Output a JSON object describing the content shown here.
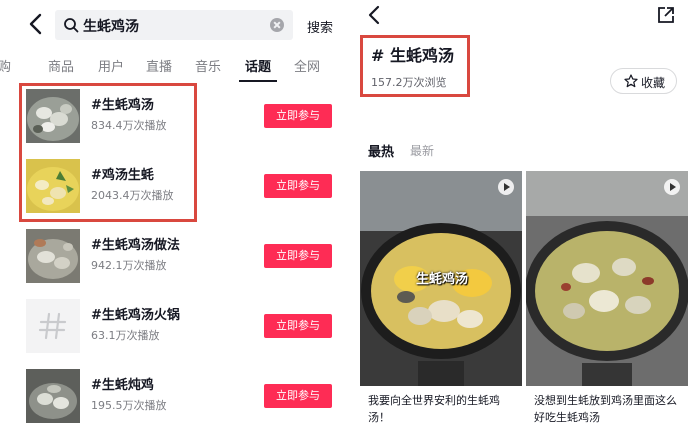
{
  "search": {
    "query": "生蚝鸡汤",
    "button": "搜索",
    "icons": {
      "back": "chevron-left-icon",
      "search": "search-icon",
      "clear": "clear-icon"
    }
  },
  "tabs": [
    {
      "label": "购",
      "active": false
    },
    {
      "label": "商品",
      "active": false
    },
    {
      "label": "用户",
      "active": false
    },
    {
      "label": "直播",
      "active": false
    },
    {
      "label": "音乐",
      "active": false
    },
    {
      "label": "话题",
      "active": true
    },
    {
      "label": "全网",
      "active": false
    }
  ],
  "results": [
    {
      "title": "#生蚝鸡汤",
      "stats": "834.4万次播放",
      "button": "立即参与",
      "thumb": "oyster-soup-photo"
    },
    {
      "title": "#鸡汤生蚝",
      "stats": "2043.4万次播放",
      "button": "立即参与",
      "thumb": "yellow-soup-photo"
    },
    {
      "title": "#生蚝鸡汤做法",
      "stats": "942.1万次播放",
      "button": "立即参与",
      "thumb": "oyster-soup-photo"
    },
    {
      "title": "#生蚝鸡汤火锅",
      "stats": "63.1万次播放",
      "button": "立即参与",
      "thumb": "hash-placeholder"
    },
    {
      "title": "#生蚝炖鸡",
      "stats": "195.5万次播放",
      "button": "立即参与",
      "thumb": "oyster-soup-photo"
    }
  ],
  "topic": {
    "title": "# 生蚝鸡汤",
    "views": "157.2万次浏览",
    "favorite": "收藏",
    "sort_hot": "最热",
    "sort_new": "最新",
    "icons": {
      "back": "chevron-left-icon",
      "share": "share-icon",
      "star": "star-icon"
    }
  },
  "videos": [
    {
      "caption": "我要向全世界安利的生蚝鸡汤！",
      "overlay": "生蚝鸡汤"
    },
    {
      "caption": "没想到生蚝放到鸡汤里面这么好吃生蚝鸡汤",
      "overlay": ""
    }
  ],
  "colors": {
    "accent": "#fe2c55",
    "highlight": "#d9483f",
    "text": "#161823",
    "muted": "#7c7d83"
  }
}
